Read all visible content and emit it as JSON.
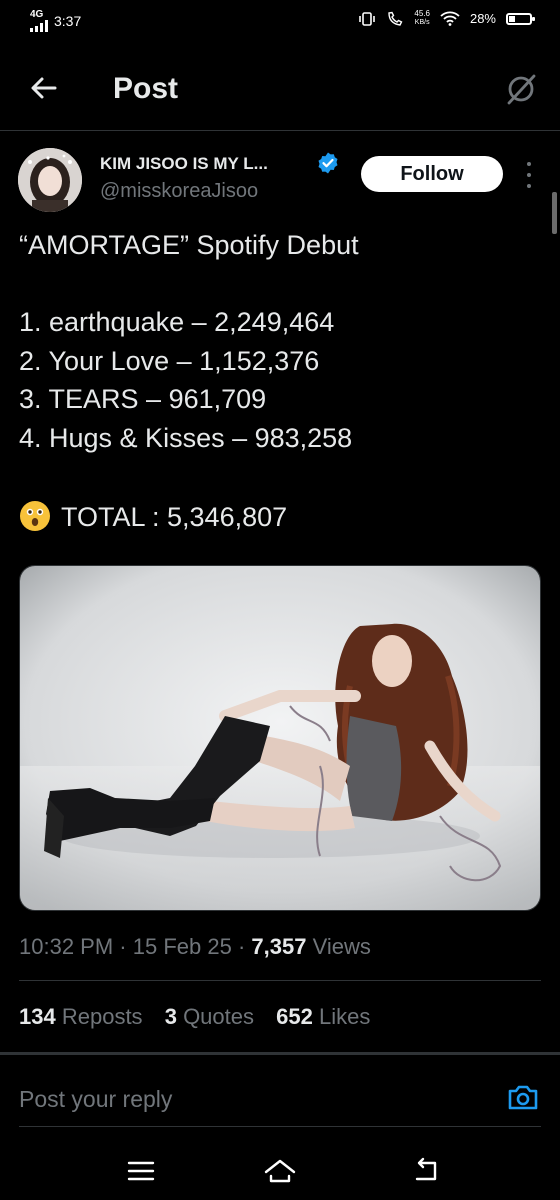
{
  "status_bar": {
    "network": "4G",
    "time": "3:37",
    "speed_top": "45.6",
    "speed_bottom": "KB/s",
    "battery_percent": "28%",
    "battery_level": 0.28
  },
  "header": {
    "title": "Post"
  },
  "author": {
    "name": "KIM JISOO IS MY L...",
    "handle": "@misskoreaJisoo",
    "follow_label": "Follow"
  },
  "tweet": {
    "title_line": "“AMORTAGE” Spotify Debut",
    "lines": [
      "1. earthquake – 2,249,464",
      "2. Your Love – 1,152,376",
      "3. TEARS – 961,709",
      "4. Hugs & Kisses – 983,258"
    ],
    "total_line": "TOTAL : 5,346,807",
    "total_emoji": "astonished-face-emoji"
  },
  "meta": {
    "time": "10:32 PM",
    "sep1": "·",
    "date": "15 Feb 25",
    "sep2": "·",
    "views_count": "7,357",
    "views_label": "Views"
  },
  "stats": {
    "reposts_count": "134",
    "reposts_label": "Reposts",
    "quotes_count": "3",
    "quotes_label": "Quotes",
    "likes_count": "652",
    "likes_label": "Likes"
  },
  "reply": {
    "placeholder": "Post your reply"
  },
  "icons": {
    "back": "back-arrow-icon",
    "grok": "grok-icon",
    "verified": "verified-badge-icon",
    "more": "more-vertical-icon",
    "camera": "camera-icon",
    "nav_menu": "menu-icon",
    "nav_home": "home-icon",
    "nav_back": "back-icon"
  },
  "colors": {
    "background": "#000000",
    "text": "#e7e9ea",
    "secondary_text": "#71767b",
    "accent": "#1d9bf0",
    "divider": "#2f3336"
  }
}
